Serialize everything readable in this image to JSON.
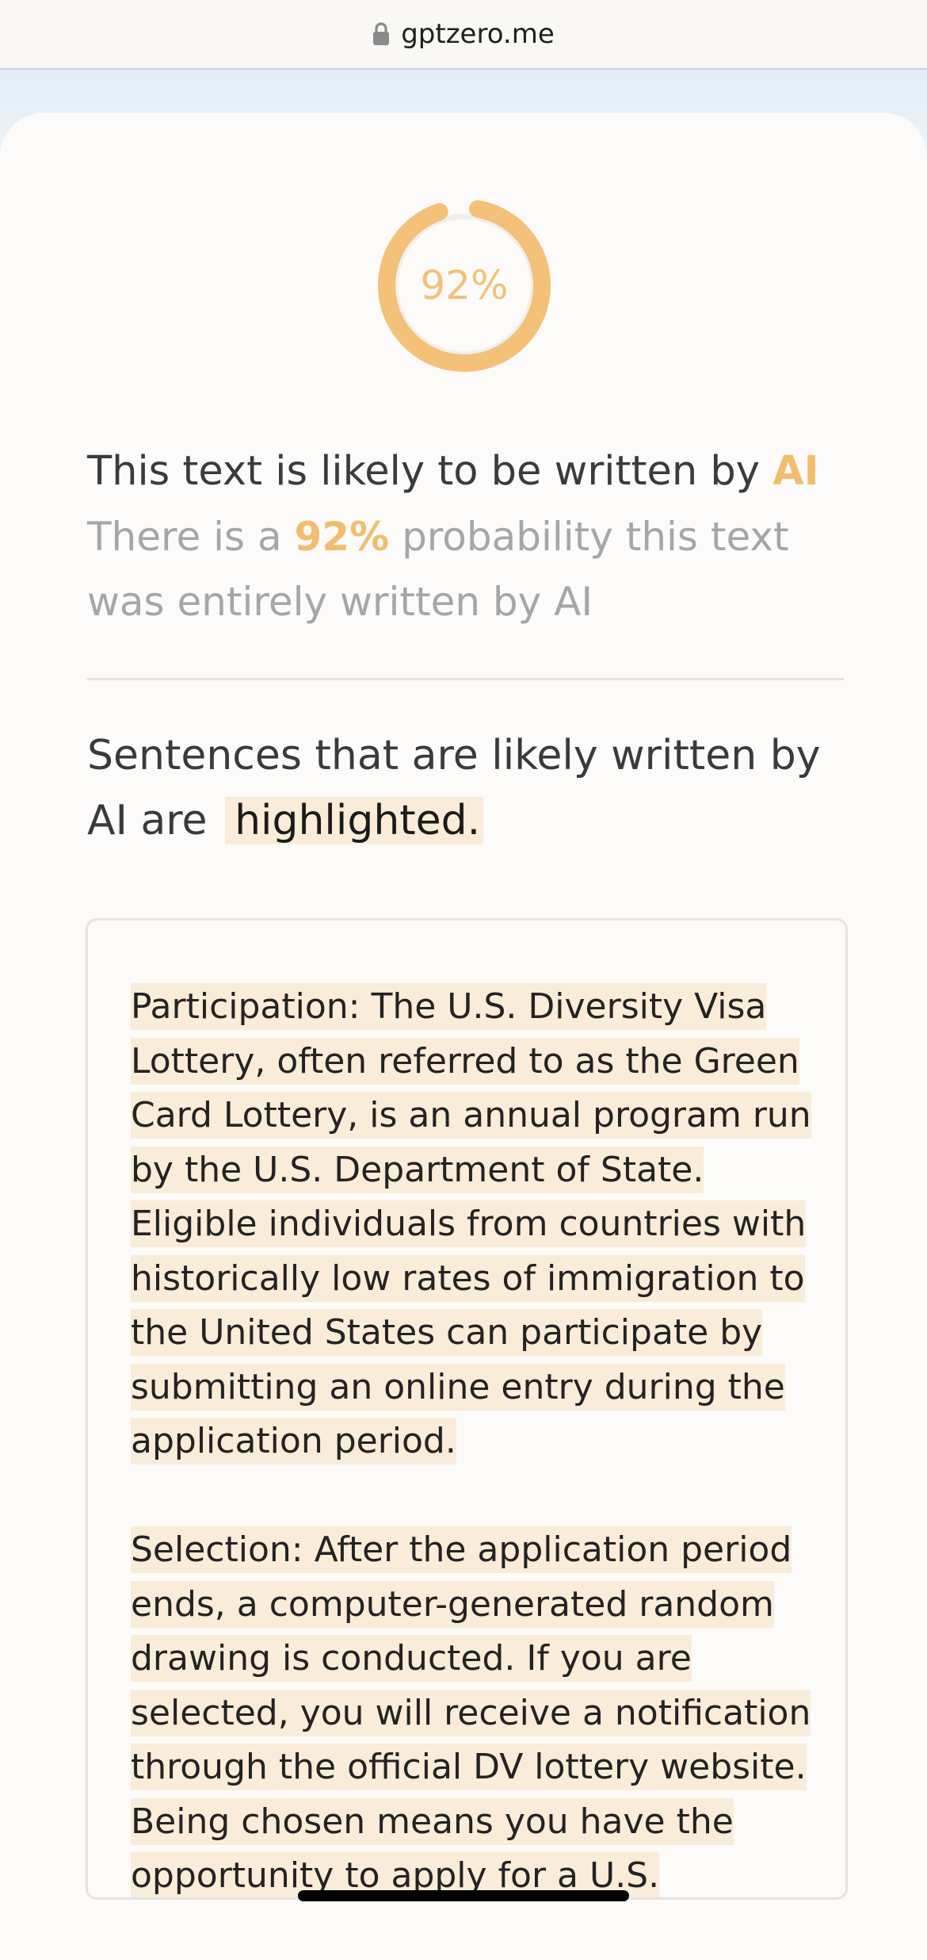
{
  "browser": {
    "url": "gptzero.me",
    "lock_icon": "lock-icon"
  },
  "result": {
    "percent": 92,
    "percent_label": "92%",
    "accent_color": "#f2bd6e",
    "headline_prefix": "This text is likely to be written by ",
    "headline_verdict": "AI",
    "probability_prefix": "There is a ",
    "probability_value": "92%",
    "probability_suffix": " probability this text was entirely written by AI"
  },
  "highlight_note": {
    "text": "Sentences that are likely written by AI are",
    "highlighted_word": "highlighted.",
    "highlight_color": "#f9ecd8"
  },
  "analyzed_text": {
    "paragraphs": [
      "Participation: The U.S. Diversity Visa Lottery, often referred to as the Green Card Lottery, is an annual program run by the U.S. Department of State. Eligible individuals from countries with historically low rates of immigration to the United States can participate by submitting an online entry during the application period.",
      "Selection: After the application period ends, a computer-generated random drawing is conducted. If you are selected, you will receive a notification through the official DV lottery website. Being chosen means you have the opportunity to apply for a U.S."
    ]
  }
}
